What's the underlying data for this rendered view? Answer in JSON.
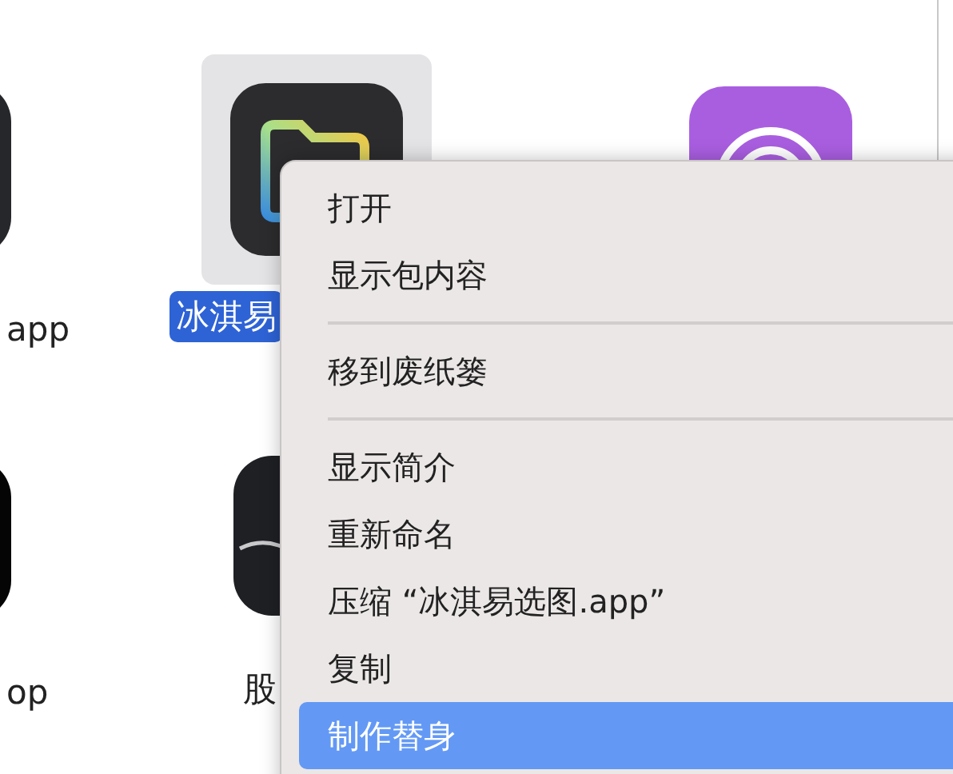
{
  "files": [
    {
      "kind": "dark-app",
      "label": "app",
      "selected": false
    },
    {
      "kind": "folder-app",
      "label": "冰淇易",
      "selected": true
    },
    {
      "kind": "target-app",
      "selected": false
    },
    {
      "kind": "black-app",
      "label": "op",
      "selected": false
    },
    {
      "kind": "stock-app",
      "label": "股",
      "selected": false
    }
  ],
  "context_menu": {
    "items": [
      {
        "kind": "item",
        "label": "打开",
        "selected": false
      },
      {
        "kind": "item",
        "label": "显示包内容",
        "selected": false
      },
      {
        "kind": "separator"
      },
      {
        "kind": "item",
        "label": "移到废纸篓",
        "selected": false
      },
      {
        "kind": "separator"
      },
      {
        "kind": "item",
        "label": "显示简介",
        "selected": false
      },
      {
        "kind": "item",
        "label": "重新命名",
        "selected": false
      },
      {
        "kind": "item",
        "label": "压缩 “冰淇易选图.app”",
        "selected": false
      },
      {
        "kind": "item",
        "label": "复制",
        "selected": false
      },
      {
        "kind": "item",
        "label": "制作替身",
        "selected": true
      }
    ]
  }
}
